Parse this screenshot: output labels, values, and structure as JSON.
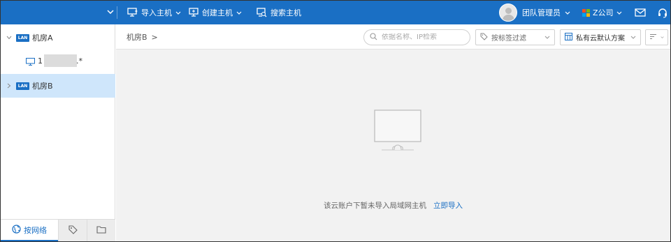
{
  "topbar": {
    "import_host": "导入主机",
    "create_host": "创建主机",
    "search_host": "搜索主机",
    "user_role": "团队管理员",
    "company": "Z公司",
    "icons": [
      "chevron-down-icon",
      "import-host-icon",
      "create-host-icon",
      "search-host-icon",
      "mail-icon",
      "headset-icon"
    ]
  },
  "sidebar": {
    "tree": [
      {
        "badge": "LAN",
        "label": "机房A",
        "expanded": true
      },
      {
        "badge": "LAN",
        "label": "机房B",
        "expanded": false,
        "selected": true
      }
    ],
    "host": {
      "prefix": "1",
      "suffix": ".*"
    },
    "tabs": [
      {
        "label": "按网络",
        "icon": "globe-icon",
        "active": true
      },
      {
        "label": "",
        "icon": "tag-icon"
      },
      {
        "label": "",
        "icon": "folder-icon"
      }
    ]
  },
  "main": {
    "breadcrumb": {
      "item": "机房B",
      "separator": ">"
    },
    "search": {
      "placeholder": "依据名称、IP检索",
      "value": ""
    },
    "tag_filter": {
      "placeholder": "按标签过滤"
    },
    "scheme": {
      "value": "私有云默认方案"
    },
    "empty": {
      "message": "该云账户下暂未导入局域网主机",
      "action": "立即导入"
    }
  },
  "colors": {
    "primary": "#1a6fc4",
    "selected_bg": "#cfe6fb",
    "main_bg": "#f2f2f2"
  }
}
